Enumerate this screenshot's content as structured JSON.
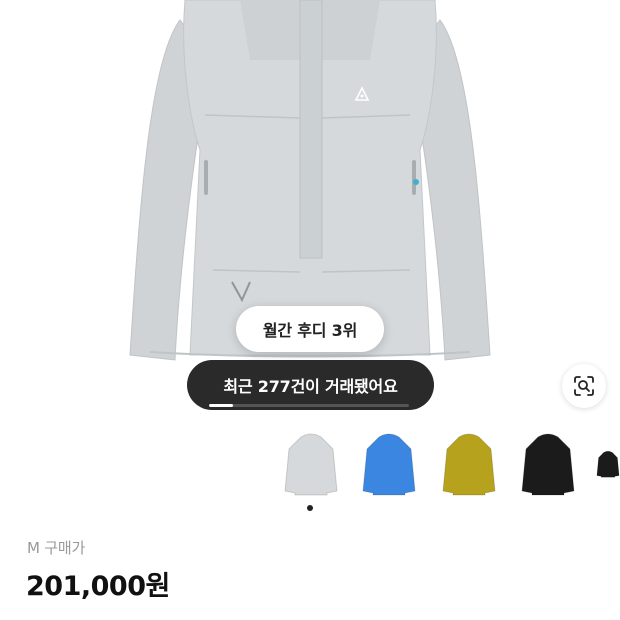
{
  "badges": {
    "ranking": "월간 후디 3위",
    "trades": "최근 277건이 거래됐어요"
  },
  "carousel": {
    "progress": 0.12
  },
  "lens_button": {
    "icon": "image-search-icon"
  },
  "thumbnails": [
    {
      "color": "#d6d9db",
      "name": "grey"
    },
    {
      "color": "#3a86e0",
      "name": "blue"
    },
    {
      "color": "#b6a21c",
      "name": "olive"
    },
    {
      "color": "#1b1b1b",
      "name": "black"
    },
    {
      "color": "#1b1b1b",
      "name": "black-2"
    }
  ],
  "product": {
    "size_label": "M 구매가",
    "price": "201,000원"
  },
  "colors": {
    "jacket": "#d4d8da",
    "dark_pill": "#2a2a2a"
  }
}
